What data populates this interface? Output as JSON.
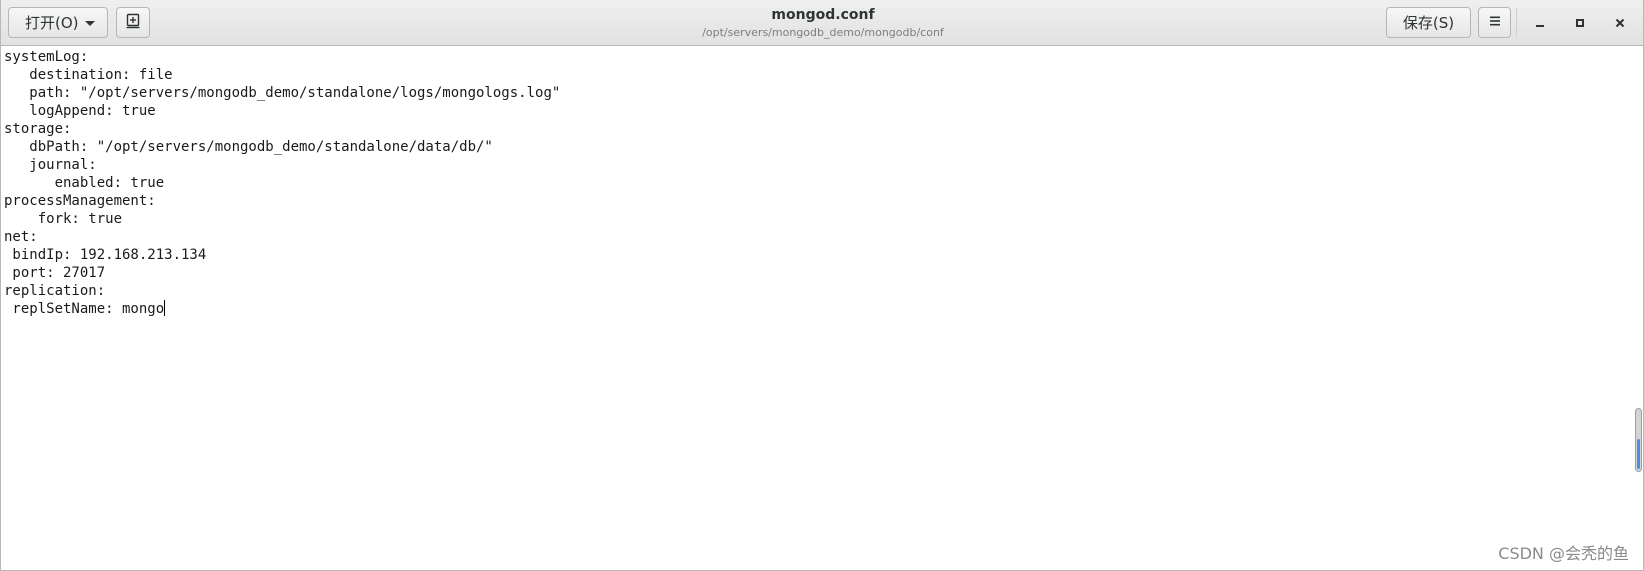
{
  "header": {
    "open_label": "打开(O)",
    "title": "mongod.conf",
    "subtitle": "/opt/servers/mongodb_demo/mongodb/conf",
    "save_label": "保存(S)"
  },
  "editor": {
    "lines": [
      "systemLog:",
      "   destination: file",
      "   path: \"/opt/servers/mongodb_demo/standalone/logs/mongologs.log\"",
      "   logAppend: true",
      "storage:",
      "   dbPath: \"/opt/servers/mongodb_demo/standalone/data/db/\"",
      "   journal:",
      "      enabled: true",
      "processManagement:",
      "    fork: true",
      "net:",
      " bindIp: 192.168.213.134",
      " port: 27017",
      "replication:",
      " replSetName: mongo"
    ]
  },
  "icons": {
    "dropdown": "chevron-down-icon",
    "new_document": "new-document-icon",
    "menu": "hamburger-menu-icon",
    "minimize": "minimize-icon",
    "maximize": "maximize-icon",
    "close": "close-icon"
  },
  "watermark": "CSDN @会秃的鱼"
}
